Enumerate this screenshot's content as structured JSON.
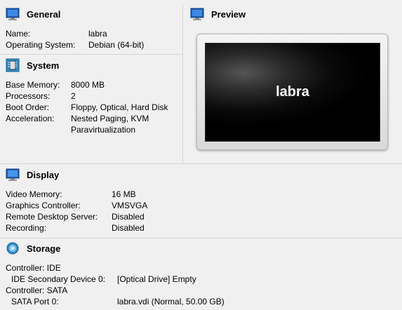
{
  "general": {
    "title": "General",
    "icon": "monitor-icon",
    "rows": [
      {
        "label": "Name:",
        "value": "labra"
      },
      {
        "label": "Operating System:",
        "value": "Debian (64-bit)"
      }
    ]
  },
  "system": {
    "title": "System",
    "icon": "chip-icon",
    "rows": [
      {
        "label": "Base Memory:",
        "value": "8000 MB"
      },
      {
        "label": "Processors:",
        "value": "2"
      },
      {
        "label": "Boot Order:",
        "value": "Floppy, Optical, Hard Disk"
      },
      {
        "label": "Acceleration:",
        "value": "Nested Paging, KVM"
      },
      {
        "label": "",
        "value": "Paravirtualization"
      }
    ]
  },
  "preview": {
    "title": "Preview",
    "icon": "monitor-icon",
    "screen_text": "labra"
  },
  "display": {
    "title": "Display",
    "icon": "display-icon",
    "rows": [
      {
        "label": "Video Memory:",
        "value": "16 MB"
      },
      {
        "label": "Graphics Controller:",
        "value": "VMSVGA"
      },
      {
        "label": "Remote Desktop Server:",
        "value": "Disabled"
      },
      {
        "label": "Recording:",
        "value": "Disabled"
      }
    ]
  },
  "storage": {
    "title": "Storage",
    "icon": "storage-icon",
    "rows": [
      {
        "label": "Controller: IDE",
        "value": ""
      },
      {
        "label": "IDE Secondary Device 0:",
        "value": "[Optical Drive] Empty"
      },
      {
        "label": "Controller: SATA",
        "value": ""
      },
      {
        "label": "SATA Port 0:",
        "value": "labra.vdi (Normal, 50.00 GB)"
      }
    ]
  }
}
